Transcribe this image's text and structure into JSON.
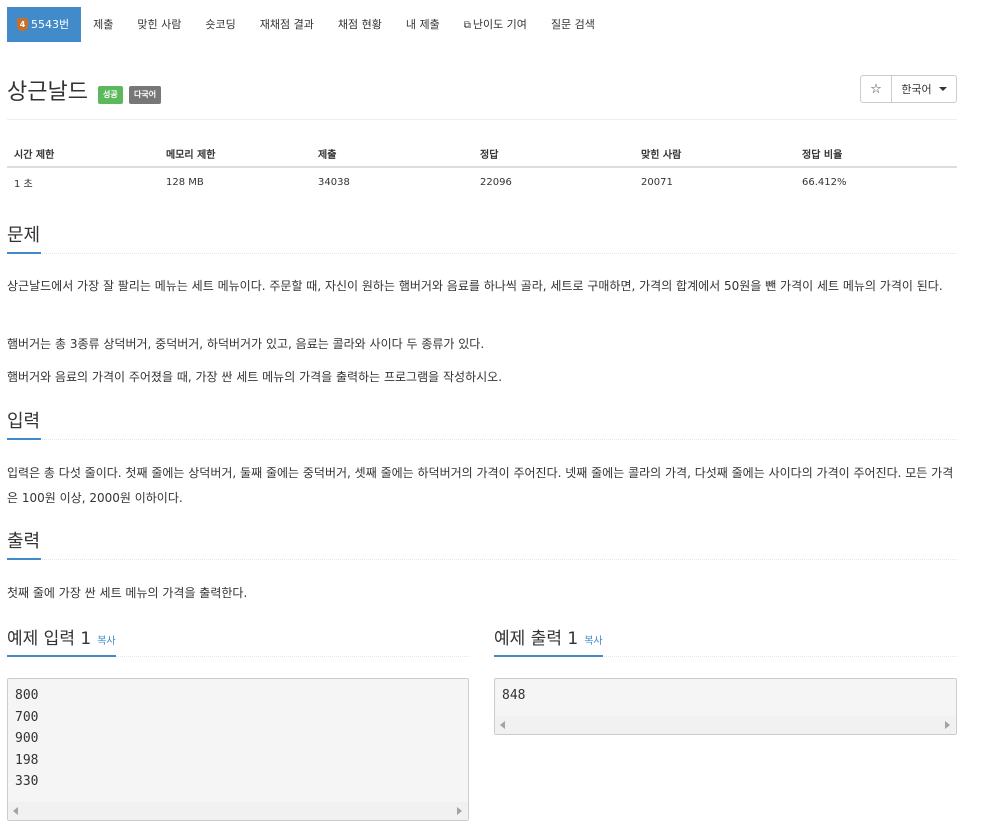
{
  "nav": {
    "problem_number": "5543번",
    "tier_badge": "4",
    "items": [
      "제출",
      "맞힌 사람",
      "숏코딩",
      "재채점 결과",
      "채점 현황",
      "내 제출",
      "난이도 기여",
      "질문 검색"
    ]
  },
  "problem": {
    "title": "상근날드",
    "badges": {
      "success": "성공",
      "multilang": "다국어"
    },
    "star": "☆",
    "language": "한국어"
  },
  "info_table": {
    "headers": [
      "시간 제한",
      "메모리 제한",
      "제출",
      "정답",
      "맞힌 사람",
      "정답 비율"
    ],
    "row": [
      "1 초",
      "128 MB",
      "34038",
      "22096",
      "20071",
      "66.412%"
    ]
  },
  "sections": {
    "description": {
      "title": "문제",
      "paragraphs": [
        "상근날드에서 가장 잘 팔리는 메뉴는 세트 메뉴이다. 주문할 때, 자신이 원하는 햄버거와 음료를 하나씩 골라, 세트로 구매하면, 가격의 합계에서 50원을 뺀 가격이 세트 메뉴의 가격이 된다.",
        "햄버거는 총 3종류 상덕버거, 중덕버거, 하덕버거가 있고, 음료는 콜라와 사이다 두 종류가 있다.",
        "햄버거와 음료의 가격이 주어졌을 때, 가장 싼 세트 메뉴의 가격을 출력하는 프로그램을 작성하시오."
      ]
    },
    "input": {
      "title": "입력",
      "text": "입력은 총 다섯 줄이다. 첫째 줄에는 상덕버거, 둘째 줄에는 중덕버거, 셋째 줄에는 하덕버거의 가격이 주어진다. 넷째 줄에는 콜라의 가격, 다섯째 줄에는 사이다의 가격이 주어진다. 모든 가격은 100원 이상, 2000원 이하이다."
    },
    "output": {
      "title": "출력",
      "text": "첫째 줄에 가장 싼 세트 메뉴의 가격을 출력한다."
    }
  },
  "samples": {
    "input": {
      "title": "예제 입력 1",
      "copy": "복사",
      "content": "800\n700\n900\n198\n330"
    },
    "output": {
      "title": "예제 출력 1",
      "copy": "복사",
      "content": "848"
    }
  },
  "colors": {
    "primary": "#428bca",
    "success": "#5cb85c",
    "muted": "#777777",
    "tier": "#c6702c"
  },
  "icons": {
    "external_link": "external-link-icon",
    "star": "star-icon",
    "dropdown": "caret-down-icon"
  }
}
